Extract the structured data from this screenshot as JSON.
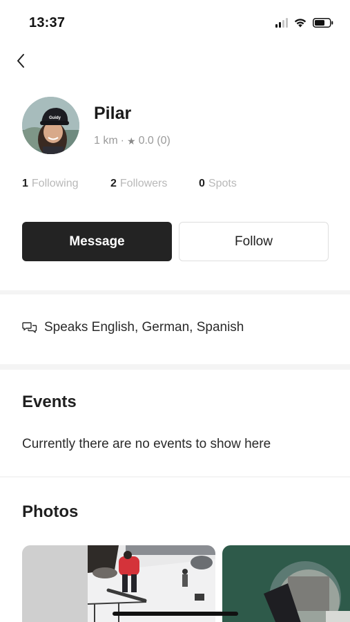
{
  "status_bar": {
    "time": "13:37"
  },
  "profile": {
    "name": "Pilar",
    "distance": "1 km",
    "separator": "·",
    "rating": "0.0 (0)",
    "star": "★"
  },
  "stats": [
    {
      "count": "1",
      "label": "Following"
    },
    {
      "count": "2",
      "label": "Followers"
    },
    {
      "count": "0",
      "label": "Spots"
    }
  ],
  "actions": {
    "message_label": "Message",
    "follow_label": "Follow"
  },
  "languages": {
    "text": "Speaks English, German, Spanish",
    "icon": "chat-bubbles-icon"
  },
  "events": {
    "title": "Events",
    "empty_text": "Currently there are no events to show here"
  },
  "photos": {
    "title": "Photos"
  },
  "colors": {
    "primary_button": "#232323",
    "muted_text": "#b8b8b8",
    "section_band": "#f4f4f4"
  }
}
